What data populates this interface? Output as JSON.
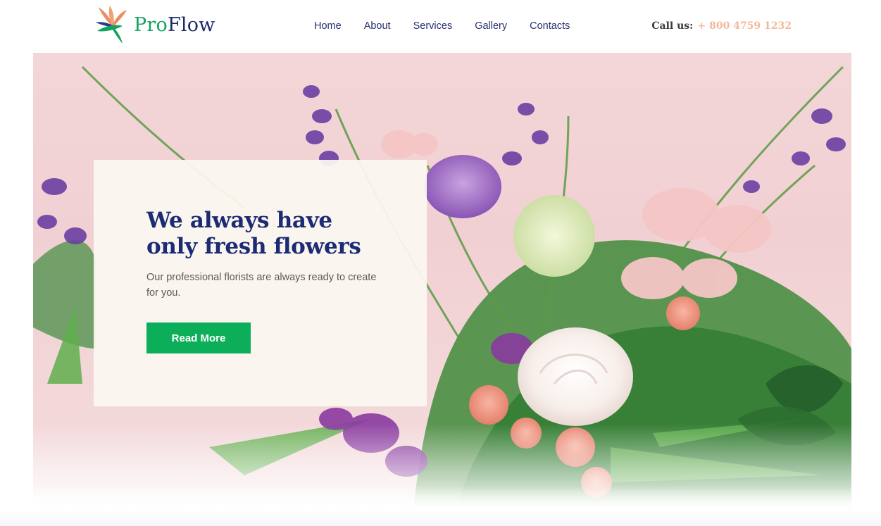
{
  "brand": {
    "name_part1": "Pro",
    "name_part2": "Flow",
    "colors": {
      "green": "#11a45e",
      "navy": "#1f2a6b",
      "peach": "#f2b89a"
    },
    "icon": "bird-of-paradise-flower-icon"
  },
  "nav": {
    "items": [
      {
        "label": "Home"
      },
      {
        "label": "About"
      },
      {
        "label": "Services"
      },
      {
        "label": "Gallery"
      },
      {
        "label": "Contacts"
      }
    ]
  },
  "contact": {
    "label": "Call us:",
    "phone": "+ 800 4759 1232"
  },
  "hero": {
    "title_line1": "We always have",
    "title_line2": "only fresh flowers",
    "text": "Our professional florists are always ready to create for you.",
    "button_label": "Read More",
    "button_color": "#0cae59",
    "image": "flower-bouquet-photo"
  }
}
